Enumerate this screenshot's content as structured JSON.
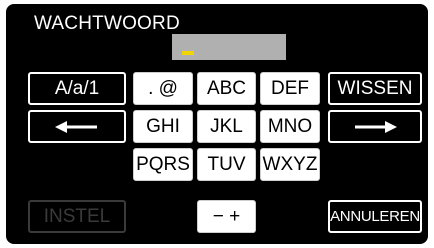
{
  "screen": {
    "title": "WACHTWOORD",
    "password_value": ""
  },
  "keys": {
    "mode": "A/a/1",
    "symbols": ". @",
    "abc": "ABC",
    "def": "DEF",
    "clear": "WISSEN",
    "ghi": "GHI",
    "jkl": "JKL",
    "mno": "MNO",
    "pqrs": "PQRS",
    "tuv": "TUV",
    "wxyz": "WXYZ",
    "set": "INSTEL",
    "plus_minus": "− +",
    "cancel": "ANNULEREN"
  },
  "icons": {
    "cursor_left": "left-arrow-icon",
    "cursor_right": "right-arrow-icon"
  },
  "colors": {
    "background": "#000000",
    "field": "#b0b0b0",
    "cursor": "#f2d400",
    "key_face": "#ffffff",
    "disabled": "#3a3a3a"
  },
  "state": {
    "set_button_enabled": false
  }
}
